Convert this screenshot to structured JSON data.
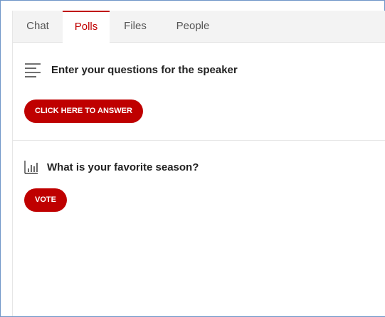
{
  "tabs": [
    {
      "label": "Chat",
      "active": false
    },
    {
      "label": "Polls",
      "active": true
    },
    {
      "label": "Files",
      "active": false
    },
    {
      "label": "People",
      "active": false
    }
  ],
  "polls": [
    {
      "icon": "lines-list-icon",
      "question": "Enter your questions for the speaker",
      "button_label": "CLICK HERE TO ANSWER"
    },
    {
      "icon": "bar-chart-icon",
      "question": "What is your favorite season?",
      "button_label": "VOTE"
    }
  ],
  "colors": {
    "accent": "#c00000",
    "button": "#bf0000",
    "frame_border": "#6f96c8",
    "tab_bar": "#f3f3f3"
  }
}
